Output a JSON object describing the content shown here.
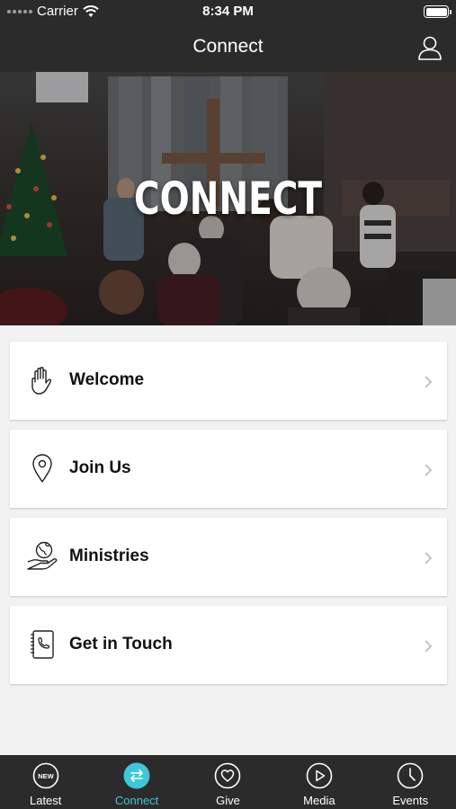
{
  "status_bar": {
    "carrier": "Carrier",
    "time": "8:34 PM"
  },
  "nav": {
    "title": "Connect",
    "profile_icon": "user-icon"
  },
  "hero": {
    "title": "CONNECT"
  },
  "menu": [
    {
      "label": "Welcome",
      "icon": "hand-wave-icon"
    },
    {
      "label": "Join Us",
      "icon": "map-pin-icon"
    },
    {
      "label": "Ministries",
      "icon": "globe-in-hand-icon"
    },
    {
      "label": "Get in Touch",
      "icon": "phone-book-icon"
    }
  ],
  "tabs": [
    {
      "label": "Latest",
      "icon": "new-badge-icon"
    },
    {
      "label": "Connect",
      "icon": "swap-arrows-icon",
      "active": true
    },
    {
      "label": "Give",
      "icon": "heart-icon"
    },
    {
      "label": "Media",
      "icon": "play-icon"
    },
    {
      "label": "Events",
      "icon": "clock-icon"
    }
  ],
  "colors": {
    "bar_background": "#2b2b2b",
    "accent": "#3ec7d8",
    "page_background": "#f2f2f2"
  }
}
